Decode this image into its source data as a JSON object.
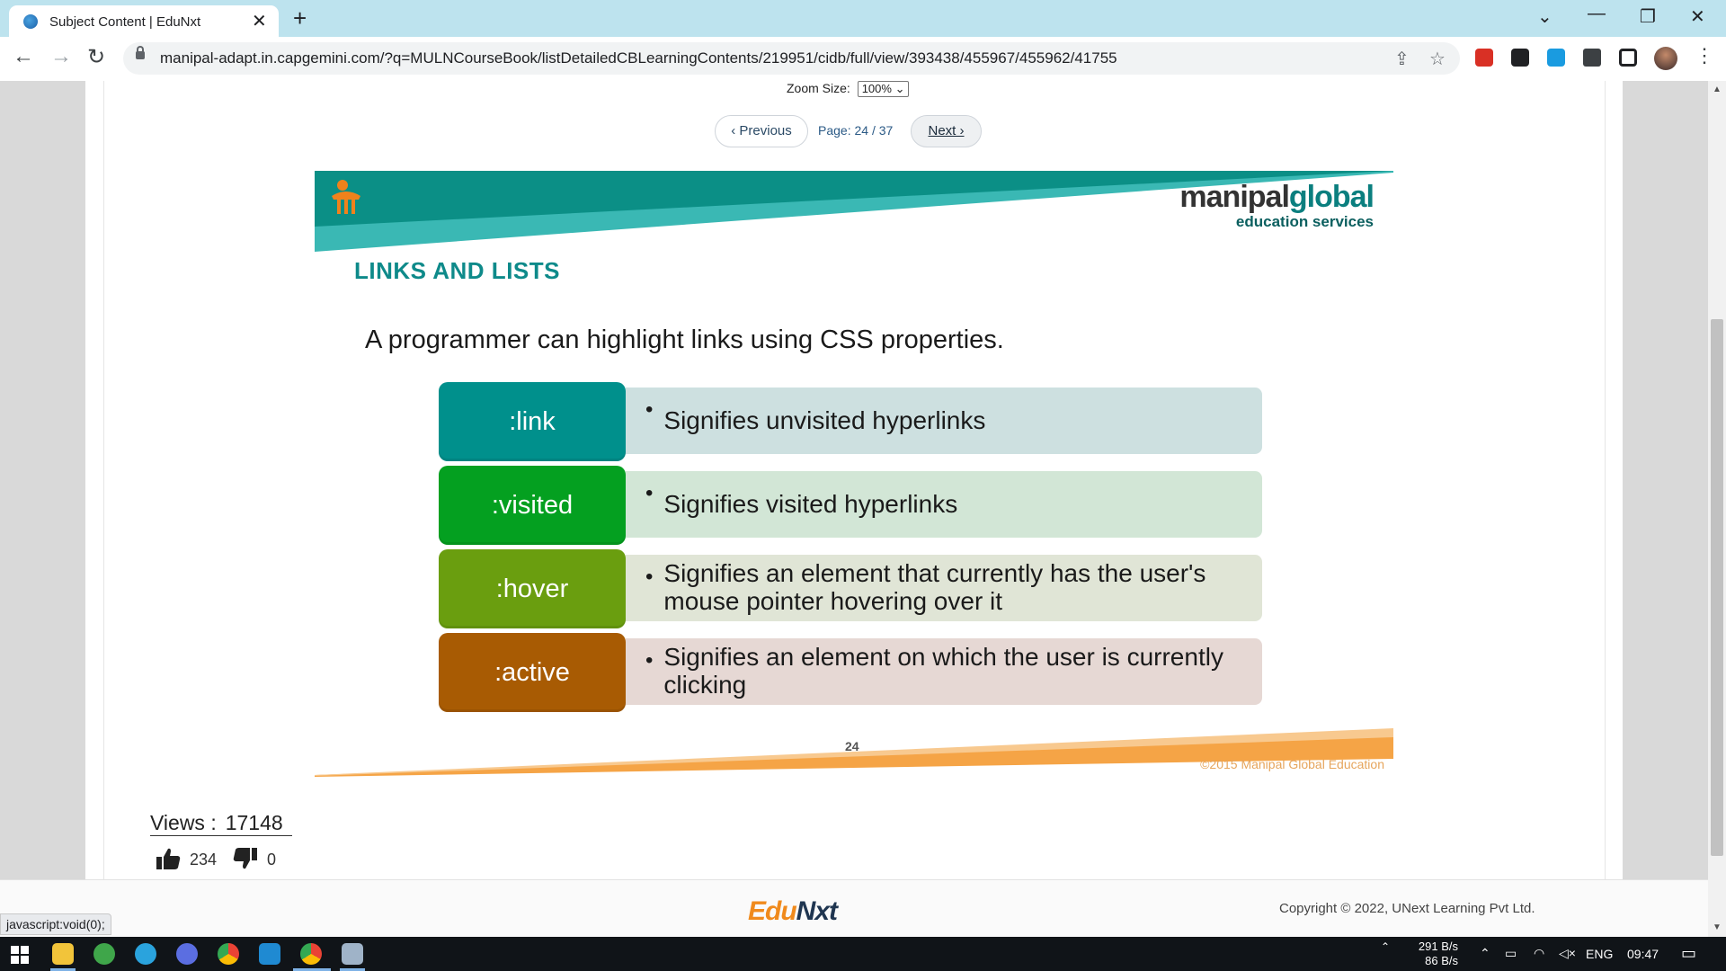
{
  "browser": {
    "tab_title": "Subject Content | EduNxt",
    "url": "manipal-adapt.in.capgemini.com/?q=MULNCourseBook/listDetailedCBLearningContents/219951/cidb/full/view/393438/455967/455962/41755",
    "icons": [
      "back-icon",
      "forward-icon",
      "reload-icon",
      "lock-icon",
      "share-icon",
      "star-icon",
      "extensions-icon",
      "sidepanel-icon",
      "profile-avatar",
      "menu-icon"
    ]
  },
  "viewer": {
    "zoom_label": "Zoom Size:",
    "zoom_value": "100%",
    "prev_label": "‹ Previous",
    "page_label": "Page:",
    "page_current": "24",
    "page_total": "37",
    "next_label": "Next ›"
  },
  "slide": {
    "brand_main_1": "manipal",
    "brand_main_2": "global",
    "brand_sub": "education services",
    "title": "LINKS AND LISTS",
    "intro": "A programmer can highlight links using CSS properties.",
    "rows": [
      {
        "label": ":link",
        "desc": "Signifies unvisited hyperlinks",
        "color": "#00908c",
        "bg": "#cde0e0"
      },
      {
        "label": ":visited",
        "desc": "Signifies visited hyperlinks",
        "color": "#04a020",
        "bg": "#d2e6d6"
      },
      {
        "label": ":hover",
        "desc": "Signifies an element that currently has the user's mouse pointer hovering over it",
        "color": "#6a9e0f",
        "bg": "#e0e5d6"
      },
      {
        "label": ":active",
        "desc": "Signifies an element on which the user is currently clicking",
        "color": "#a85b03",
        "bg": "#e6d8d4"
      }
    ],
    "page_number": "24",
    "footer_copyright": "©2015 Manipal Global Education"
  },
  "stats": {
    "views_label": "Views :",
    "views_value": "17148",
    "likes": "234",
    "dislikes": "0"
  },
  "footer": {
    "logo_1": "Edu",
    "logo_2": "Nxt",
    "copyright": "Copyright © 2022, UNext Learning Pvt Ltd."
  },
  "status_bar": "javascript:void(0);",
  "taskbar": {
    "net_up": "291 B/s",
    "net_down": "86 B/s",
    "language": "ENG",
    "time": "09:47"
  },
  "colors": {
    "teal": "#0e8a8a",
    "orange": "#f5a446",
    "chrome_bg": "#bde3ee"
  }
}
